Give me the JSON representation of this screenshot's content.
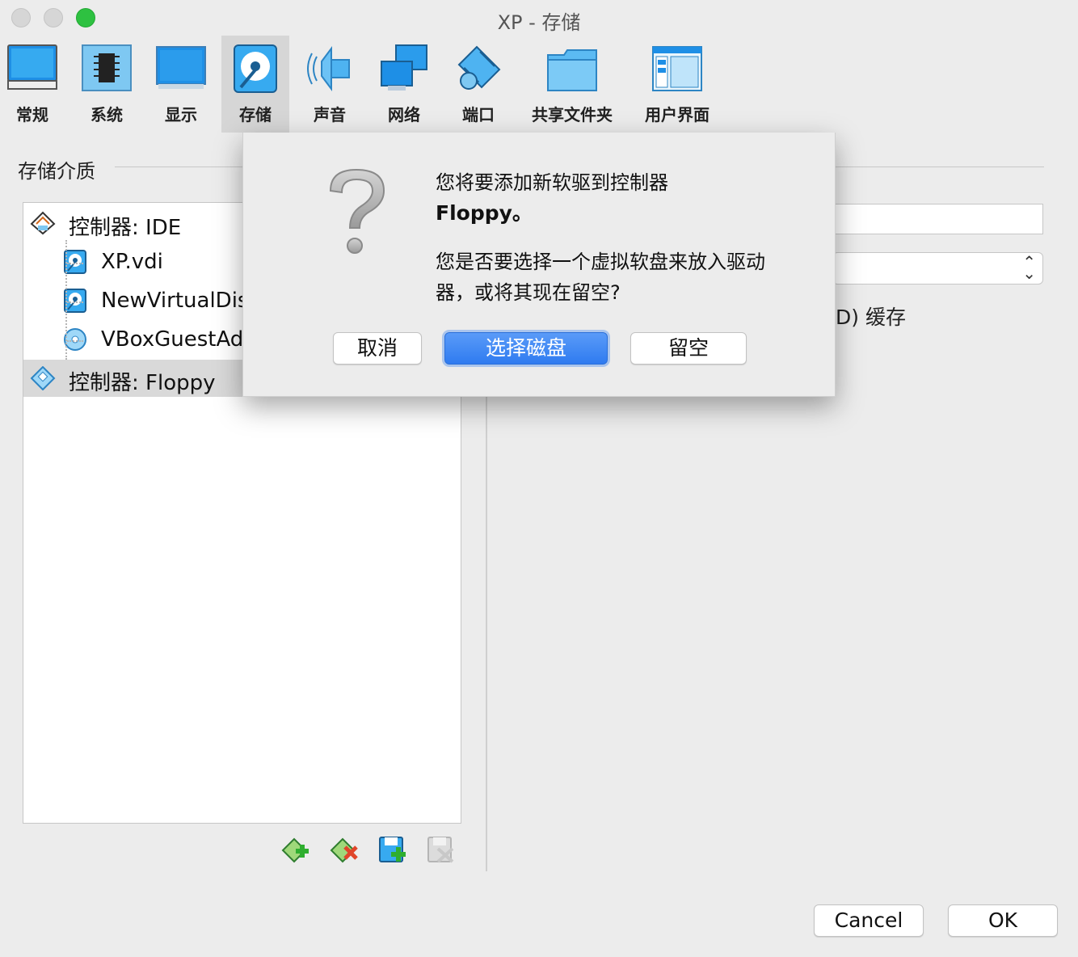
{
  "window": {
    "title": "XP - 存储"
  },
  "toolbar": {
    "items": [
      {
        "label": "常规",
        "icon": "general-monitor-icon"
      },
      {
        "label": "系统",
        "icon": "system-chip-icon"
      },
      {
        "label": "显示",
        "icon": "display-monitor-icon"
      },
      {
        "label": "存储",
        "icon": "storage-disk-icon",
        "active": true
      },
      {
        "label": "声音",
        "icon": "audio-speaker-icon"
      },
      {
        "label": "网络",
        "icon": "network-icon"
      },
      {
        "label": "端口",
        "icon": "serial-port-icon"
      },
      {
        "label": "共享文件夹",
        "icon": "shared-folder-icon"
      },
      {
        "label": "用户界面",
        "icon": "user-interface-icon"
      }
    ]
  },
  "storage": {
    "section_title": "存储介质",
    "tree": [
      {
        "label": "控制器: IDE",
        "type": "controller",
        "icon": "ide-controller-icon"
      },
      {
        "label": "XP.vdi",
        "type": "disk",
        "icon": "hard-disk-icon"
      },
      {
        "label": "NewVirtualDisk",
        "type": "disk",
        "icon": "hard-disk-icon"
      },
      {
        "label": "VBoxGuestAdditions",
        "type": "optical",
        "icon": "optical-disc-icon"
      },
      {
        "label": "控制器: Floppy",
        "type": "controller",
        "icon": "floppy-controller-icon",
        "selected": true
      }
    ],
    "tools": [
      "add-controller-icon",
      "remove-controller-icon",
      "add-attachment-icon",
      "remove-attachment-icon"
    ]
  },
  "attributes": {
    "cache_label_fragment": "D) 缓存"
  },
  "dialog": {
    "line1": "您将要添加新软驱到控制器",
    "line2": "Floppy。",
    "line3": "您是否要选择一个虚拟软盘来放入驱动器，或将其现在留空?",
    "cancel_label": "取消",
    "choose_label": "选择磁盘",
    "leave_empty_label": "留空"
  },
  "footer": {
    "cancel_label": "Cancel",
    "ok_label": "OK"
  },
  "colors": {
    "accent_blue": "#2f7bf0",
    "icon_blue": "#35a6ea",
    "window_bg": "#ececec"
  }
}
